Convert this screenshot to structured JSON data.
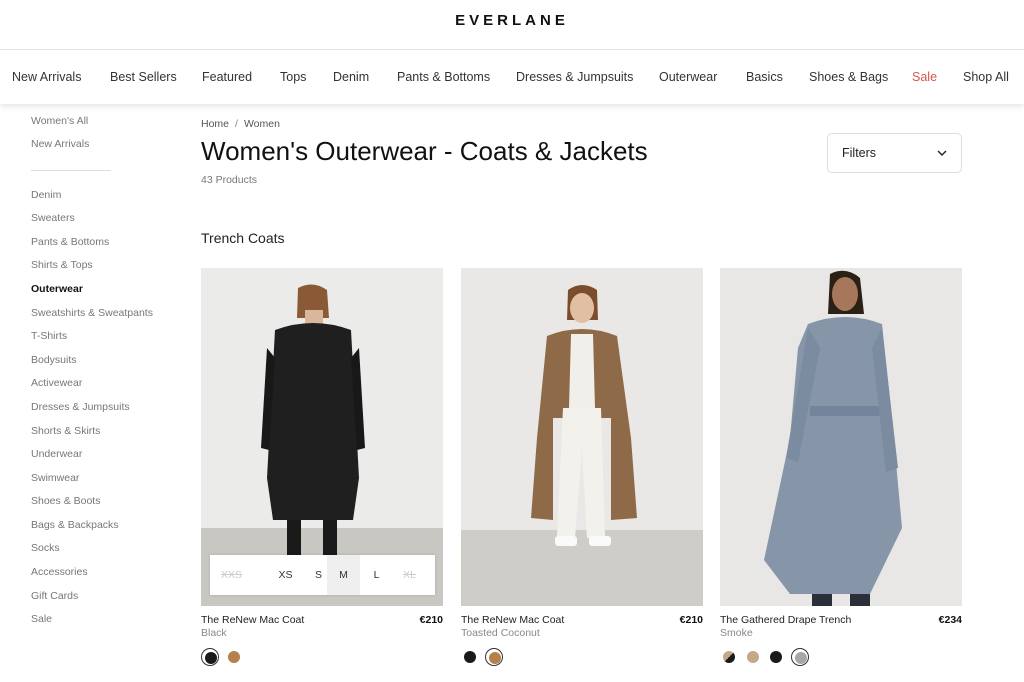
{
  "brand": "EVERLANE",
  "nav": [
    "New Arrivals",
    "Best Sellers",
    "Featured",
    "Tops",
    "Denim",
    "Pants & Bottoms",
    "Dresses & Jumpsuits",
    "Outerwear",
    "Basics",
    "Shoes & Bags",
    "Sale",
    "Shop All"
  ],
  "sidebar": {
    "top": [
      "Women's All",
      "New Arrivals"
    ],
    "categories": [
      "Denim",
      "Sweaters",
      "Pants & Bottoms",
      "Shirts & Tops",
      "Outerwear",
      "Sweatshirts & Sweatpants",
      "T-Shirts",
      "Bodysuits",
      "Activewear",
      "Dresses & Jumpsuits",
      "Shorts & Skirts",
      "Underwear",
      "Swimwear",
      "Shoes & Boots",
      "Bags & Backpacks",
      "Socks",
      "Accessories",
      "Gift Cards",
      "Sale"
    ],
    "active": "Outerwear"
  },
  "breadcrumb": {
    "home": "Home",
    "sep": "/",
    "current": "Women"
  },
  "page_title": "Women's Outerwear - Coats & Jackets",
  "product_count": "43 Products",
  "filters_label": "Filters",
  "section_title": "Trench Coats",
  "colors": {
    "accent_sale": "#d9534f",
    "text": "#222222"
  },
  "products": [
    {
      "name": "The ReNew Mac Coat",
      "price": "€210",
      "color": "Black",
      "swatches": [
        "#1a1a1a",
        "#b5804a"
      ],
      "selected_swatch": 0,
      "sizes": [
        {
          "label": "XXS",
          "available": false
        },
        {
          "label": "XS",
          "available": true
        },
        {
          "label": "S",
          "available": true
        },
        {
          "label": "M",
          "available": true,
          "hover": true
        },
        {
          "label": "L",
          "available": true
        },
        {
          "label": "XL",
          "available": false
        }
      ]
    },
    {
      "name": "The ReNew Mac Coat",
      "price": "€210",
      "color": "Toasted Coconut",
      "swatches": [
        "#1a1a1a",
        "#b5804a"
      ],
      "selected_swatch": 1
    },
    {
      "name": "The Gathered Drape Trench",
      "price": "€234",
      "color": "Smoke",
      "swatches": [
        "split",
        "#c4a88a",
        "#1a1a1a",
        "#a4a8ad"
      ],
      "selected_swatch": 3
    }
  ]
}
